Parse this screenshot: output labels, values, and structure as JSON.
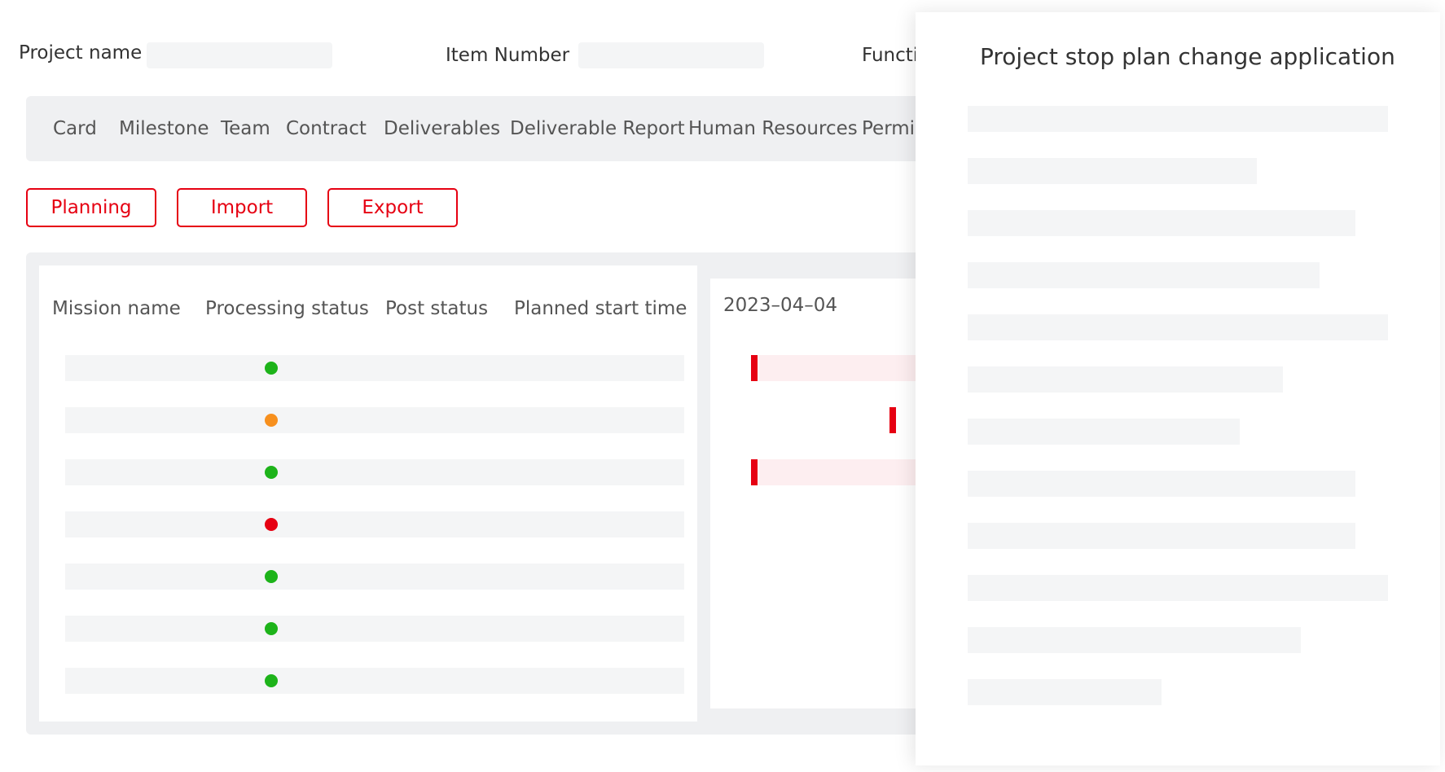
{
  "filters": {
    "project_name_label": "Project name",
    "item_number_label": "Item Number",
    "function_label": "Functi"
  },
  "tabs": [
    "Card",
    "Milestone",
    "Team",
    "Contract",
    "Deliverables",
    "Deliverable Report",
    "Human Resources",
    "Permis"
  ],
  "toolbar": {
    "planning_label": "Planning",
    "import_label": "Import",
    "export_label": "Export"
  },
  "table": {
    "headers": [
      "Mission name",
      "Processing status",
      "Post status",
      "Planned start time"
    ],
    "rows": [
      {
        "status_color": "#1db31a"
      },
      {
        "status_color": "#f7901e"
      },
      {
        "status_color": "#1db31a"
      },
      {
        "status_color": "#e60012"
      },
      {
        "status_color": "#1db31a"
      },
      {
        "status_color": "#1db31a"
      },
      {
        "status_color": "#1db31a"
      }
    ]
  },
  "gantt": {
    "date": "2023–04–04"
  },
  "drawer": {
    "title": "Project stop plan change application"
  },
  "colors": {
    "accent": "#e60012",
    "green": "#1db31a",
    "orange": "#f7901e",
    "red": "#e60012"
  }
}
